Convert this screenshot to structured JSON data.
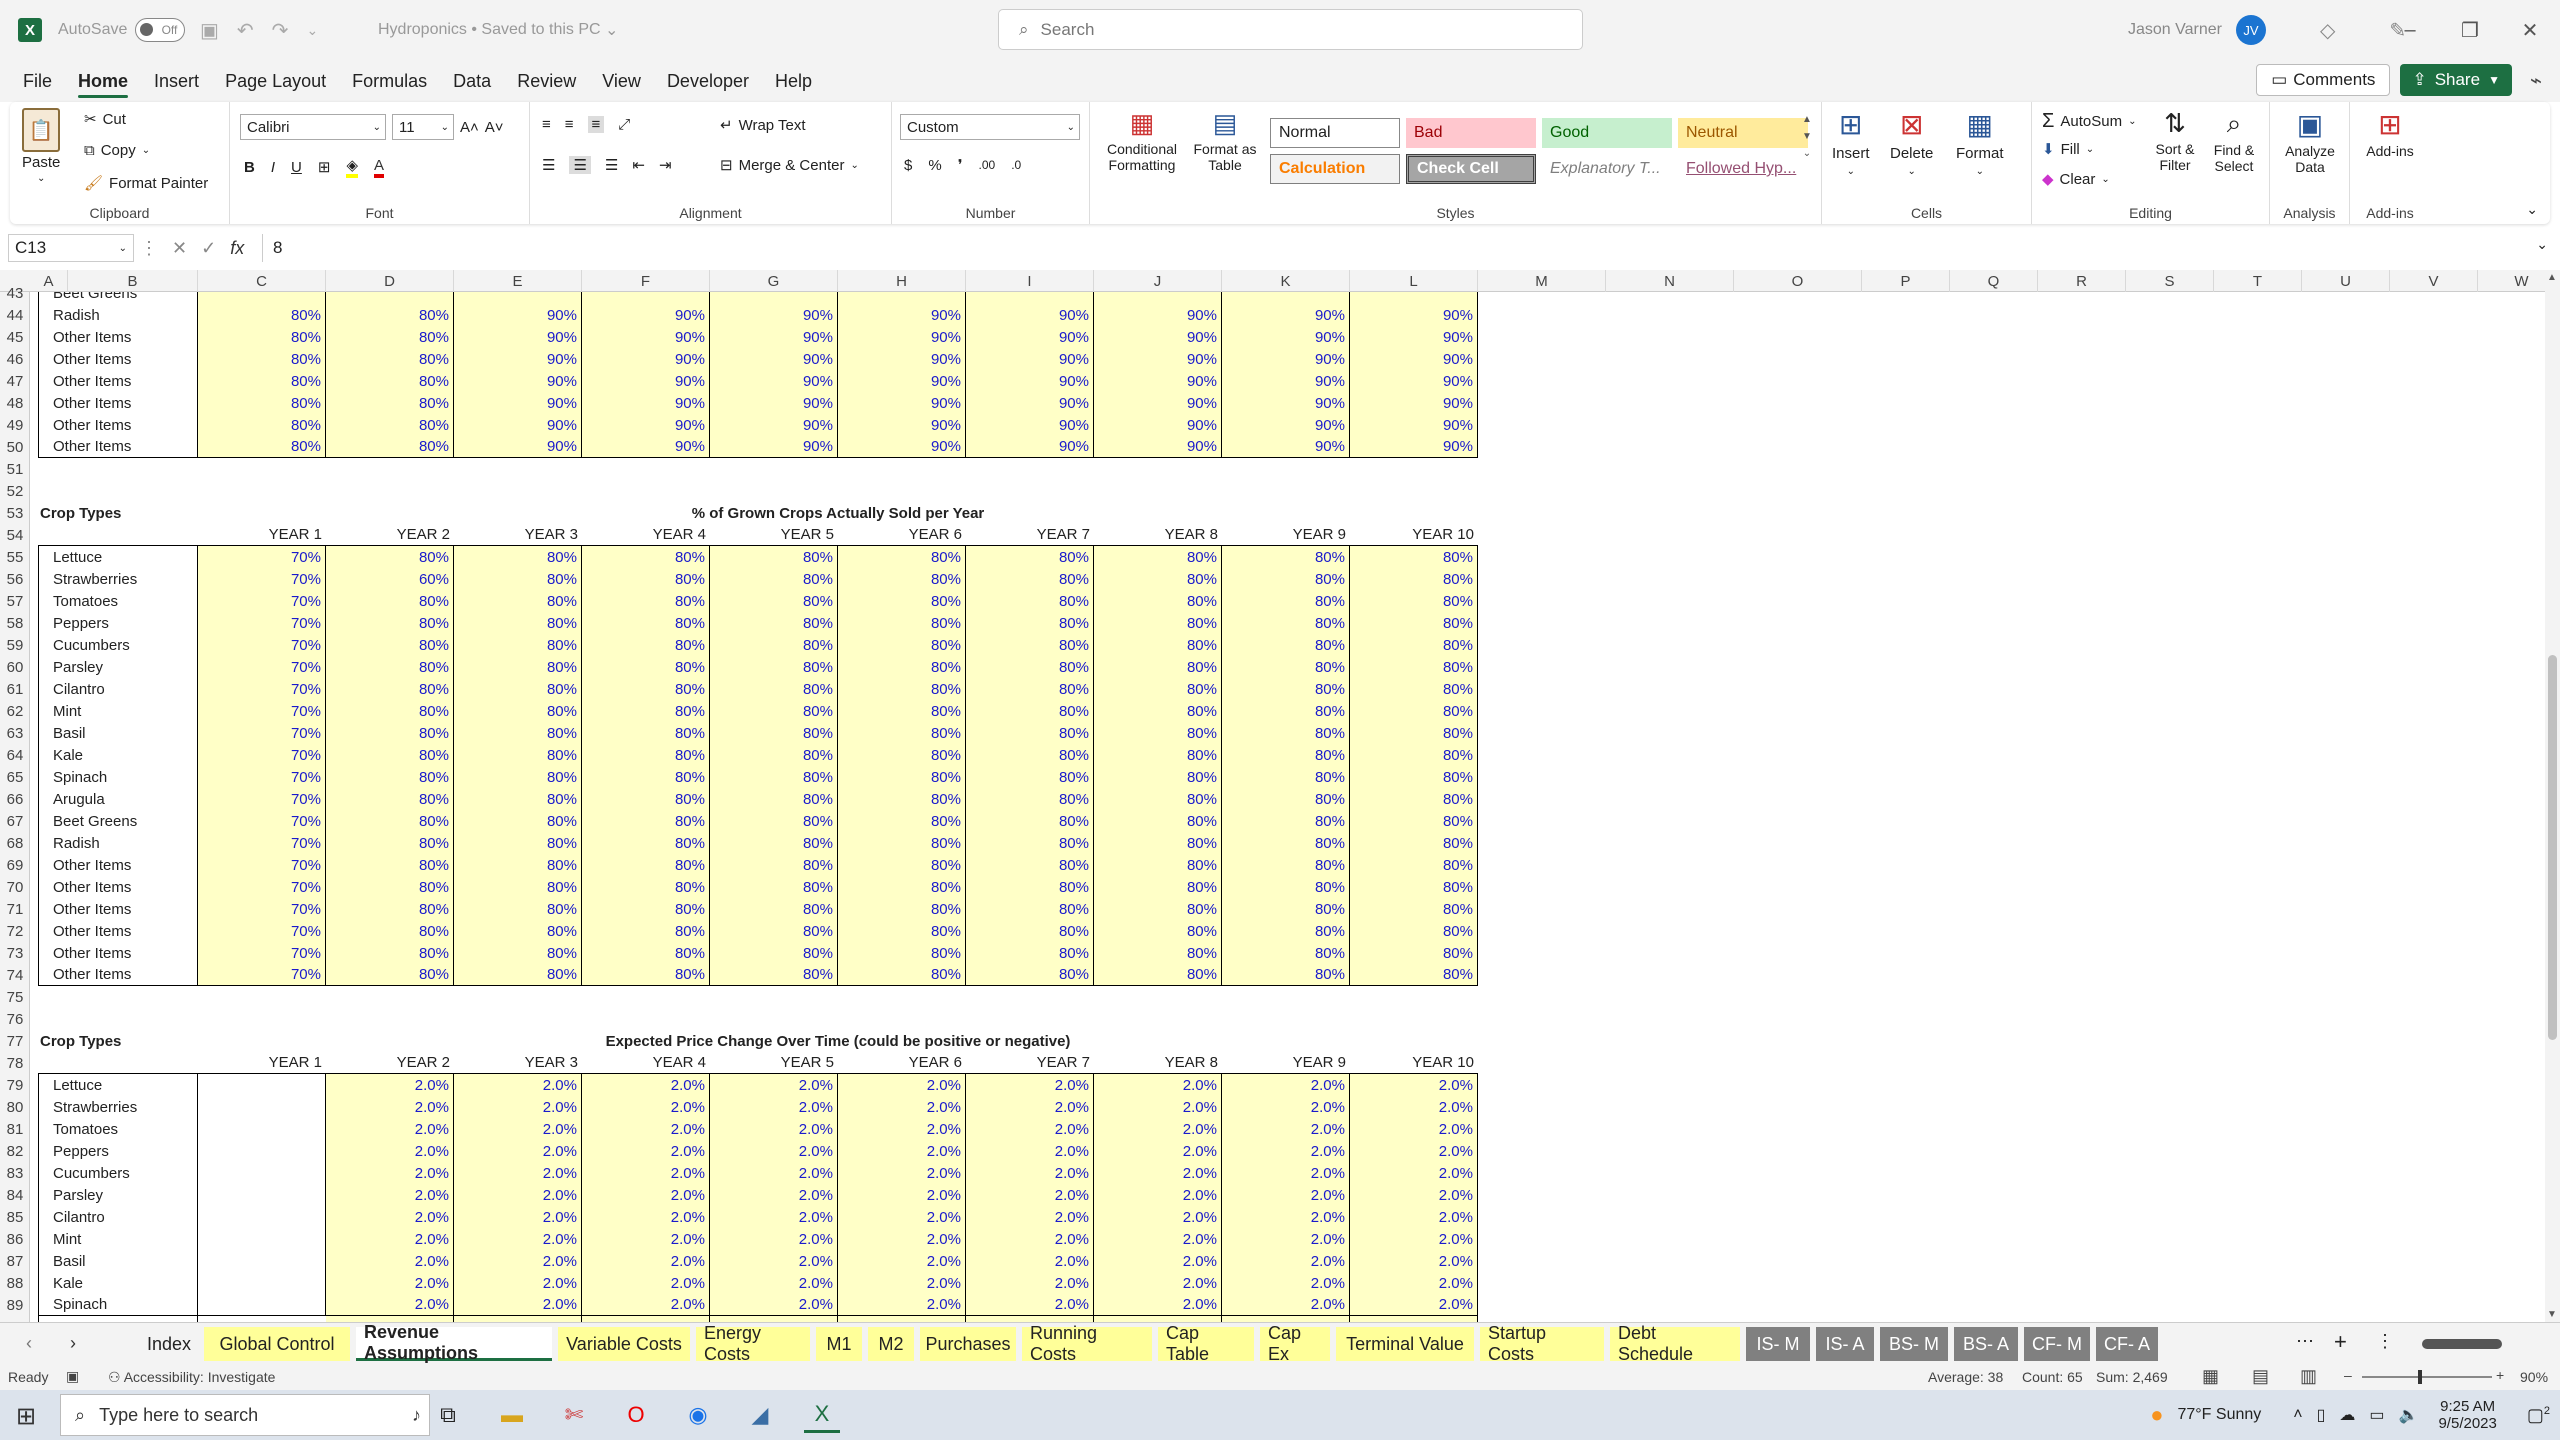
{
  "titlebar": {
    "autosave_label": "AutoSave",
    "autosave_state": "Off",
    "doc_title": "Hydroponics • Saved to this PC",
    "search_placeholder": "Search",
    "user_name": "Jason Varner",
    "user_initials": "JV"
  },
  "menu": {
    "tabs": [
      "File",
      "Home",
      "Insert",
      "Page Layout",
      "Formulas",
      "Data",
      "Review",
      "View",
      "Developer",
      "Help"
    ],
    "active": "Home",
    "comments": "Comments",
    "share": "Share"
  },
  "ribbon": {
    "clipboard": {
      "paste": "Paste",
      "cut": "Cut",
      "copy": "Copy",
      "format_painter": "Format Painter",
      "label": "Clipboard"
    },
    "font": {
      "name": "Calibri",
      "size": "11",
      "label": "Font"
    },
    "alignment": {
      "wrap": "Wrap Text",
      "merge": "Merge & Center",
      "label": "Alignment"
    },
    "number": {
      "format": "Custom",
      "label": "Number"
    },
    "styles": {
      "cond": "Conditional Formatting",
      "table": "Format as Table",
      "normal": "Normal",
      "bad": "Bad",
      "good": "Good",
      "neutral": "Neutral",
      "calculation": "Calculation",
      "check": "Check Cell",
      "explanatory": "Explanatory T...",
      "followed": "Followed Hyp...",
      "label": "Styles"
    },
    "cells": {
      "insert": "Insert",
      "delete": "Delete",
      "format": "Format",
      "label": "Cells"
    },
    "editing": {
      "autosum": "AutoSum",
      "fill": "Fill",
      "clear": "Clear",
      "sort": "Sort & Filter",
      "find": "Find & Select",
      "label": "Editing"
    },
    "analysis": {
      "analyze": "Analyze Data",
      "label": "Analysis"
    },
    "addins": {
      "addins": "Add-ins",
      "label": "Add-ins"
    }
  },
  "formula": {
    "name_box": "C13",
    "value": "8"
  },
  "columns": [
    "A",
    "B",
    "C",
    "D",
    "E",
    "F",
    "G",
    "H",
    "I",
    "J",
    "K",
    "L",
    "M",
    "N",
    "O",
    "P",
    "Q",
    "R",
    "S",
    "T",
    "U",
    "V",
    "W"
  ],
  "years": [
    "YEAR 1",
    "YEAR 2",
    "YEAR 3",
    "YEAR 4",
    "YEAR 5",
    "YEAR 6",
    "YEAR 7",
    "YEAR 8",
    "YEAR 9",
    "YEAR 10"
  ],
  "section1": {
    "partial_row_num": "43",
    "partial_label": "Beet Greens",
    "rows": [
      {
        "num": "44",
        "label": "Radish",
        "values": [
          "80%",
          "80%",
          "90%",
          "90%",
          "90%",
          "90%",
          "90%",
          "90%",
          "90%",
          "90%"
        ]
      },
      {
        "num": "45",
        "label": "Other Items",
        "values": [
          "80%",
          "80%",
          "90%",
          "90%",
          "90%",
          "90%",
          "90%",
          "90%",
          "90%",
          "90%"
        ]
      },
      {
        "num": "46",
        "label": "Other Items",
        "values": [
          "80%",
          "80%",
          "90%",
          "90%",
          "90%",
          "90%",
          "90%",
          "90%",
          "90%",
          "90%"
        ]
      },
      {
        "num": "47",
        "label": "Other Items",
        "values": [
          "80%",
          "80%",
          "90%",
          "90%",
          "90%",
          "90%",
          "90%",
          "90%",
          "90%",
          "90%"
        ]
      },
      {
        "num": "48",
        "label": "Other Items",
        "values": [
          "80%",
          "80%",
          "90%",
          "90%",
          "90%",
          "90%",
          "90%",
          "90%",
          "90%",
          "90%"
        ]
      },
      {
        "num": "49",
        "label": "Other Items",
        "values": [
          "80%",
          "80%",
          "90%",
          "90%",
          "90%",
          "90%",
          "90%",
          "90%",
          "90%",
          "90%"
        ]
      },
      {
        "num": "50",
        "label": "Other Items",
        "values": [
          "80%",
          "80%",
          "90%",
          "90%",
          "90%",
          "90%",
          "90%",
          "90%",
          "90%",
          "90%"
        ]
      }
    ],
    "blank_rows": [
      "51",
      "52"
    ]
  },
  "section2": {
    "title_row": "53",
    "header_row": "54",
    "crop_types": "Crop Types",
    "title": "% of Grown Crops Actually Sold per Year",
    "rows": [
      {
        "num": "55",
        "label": "Lettuce",
        "values": [
          "70%",
          "80%",
          "80%",
          "80%",
          "80%",
          "80%",
          "80%",
          "80%",
          "80%",
          "80%"
        ]
      },
      {
        "num": "56",
        "label": "Strawberries",
        "values": [
          "70%",
          "60%",
          "80%",
          "80%",
          "80%",
          "80%",
          "80%",
          "80%",
          "80%",
          "80%"
        ]
      },
      {
        "num": "57",
        "label": "Tomatoes",
        "values": [
          "70%",
          "80%",
          "80%",
          "80%",
          "80%",
          "80%",
          "80%",
          "80%",
          "80%",
          "80%"
        ]
      },
      {
        "num": "58",
        "label": "Peppers",
        "values": [
          "70%",
          "80%",
          "80%",
          "80%",
          "80%",
          "80%",
          "80%",
          "80%",
          "80%",
          "80%"
        ]
      },
      {
        "num": "59",
        "label": "Cucumbers",
        "values": [
          "70%",
          "80%",
          "80%",
          "80%",
          "80%",
          "80%",
          "80%",
          "80%",
          "80%",
          "80%"
        ]
      },
      {
        "num": "60",
        "label": "Parsley",
        "values": [
          "70%",
          "80%",
          "80%",
          "80%",
          "80%",
          "80%",
          "80%",
          "80%",
          "80%",
          "80%"
        ]
      },
      {
        "num": "61",
        "label": "Cilantro",
        "values": [
          "70%",
          "80%",
          "80%",
          "80%",
          "80%",
          "80%",
          "80%",
          "80%",
          "80%",
          "80%"
        ]
      },
      {
        "num": "62",
        "label": "Mint",
        "values": [
          "70%",
          "80%",
          "80%",
          "80%",
          "80%",
          "80%",
          "80%",
          "80%",
          "80%",
          "80%"
        ]
      },
      {
        "num": "63",
        "label": "Basil",
        "values": [
          "70%",
          "80%",
          "80%",
          "80%",
          "80%",
          "80%",
          "80%",
          "80%",
          "80%",
          "80%"
        ]
      },
      {
        "num": "64",
        "label": "Kale",
        "values": [
          "70%",
          "80%",
          "80%",
          "80%",
          "80%",
          "80%",
          "80%",
          "80%",
          "80%",
          "80%"
        ]
      },
      {
        "num": "65",
        "label": "Spinach",
        "values": [
          "70%",
          "80%",
          "80%",
          "80%",
          "80%",
          "80%",
          "80%",
          "80%",
          "80%",
          "80%"
        ]
      },
      {
        "num": "66",
        "label": "Arugula",
        "values": [
          "70%",
          "80%",
          "80%",
          "80%",
          "80%",
          "80%",
          "80%",
          "80%",
          "80%",
          "80%"
        ]
      },
      {
        "num": "67",
        "label": "Beet Greens",
        "values": [
          "70%",
          "80%",
          "80%",
          "80%",
          "80%",
          "80%",
          "80%",
          "80%",
          "80%",
          "80%"
        ]
      },
      {
        "num": "68",
        "label": "Radish",
        "values": [
          "70%",
          "80%",
          "80%",
          "80%",
          "80%",
          "80%",
          "80%",
          "80%",
          "80%",
          "80%"
        ]
      },
      {
        "num": "69",
        "label": "Other Items",
        "values": [
          "70%",
          "80%",
          "80%",
          "80%",
          "80%",
          "80%",
          "80%",
          "80%",
          "80%",
          "80%"
        ]
      },
      {
        "num": "70",
        "label": "Other Items",
        "values": [
          "70%",
          "80%",
          "80%",
          "80%",
          "80%",
          "80%",
          "80%",
          "80%",
          "80%",
          "80%"
        ]
      },
      {
        "num": "71",
        "label": "Other Items",
        "values": [
          "70%",
          "80%",
          "80%",
          "80%",
          "80%",
          "80%",
          "80%",
          "80%",
          "80%",
          "80%"
        ]
      },
      {
        "num": "72",
        "label": "Other Items",
        "values": [
          "70%",
          "80%",
          "80%",
          "80%",
          "80%",
          "80%",
          "80%",
          "80%",
          "80%",
          "80%"
        ]
      },
      {
        "num": "73",
        "label": "Other Items",
        "values": [
          "70%",
          "80%",
          "80%",
          "80%",
          "80%",
          "80%",
          "80%",
          "80%",
          "80%",
          "80%"
        ]
      },
      {
        "num": "74",
        "label": "Other Items",
        "values": [
          "70%",
          "80%",
          "80%",
          "80%",
          "80%",
          "80%",
          "80%",
          "80%",
          "80%",
          "80%"
        ]
      }
    ],
    "blank_rows": [
      "75",
      "76"
    ]
  },
  "section3": {
    "title_row": "77",
    "header_row": "78",
    "crop_types": "Crop Types",
    "title": "Expected Price Change Over Time (could be positive or negative)",
    "rows": [
      {
        "num": "79",
        "label": "Lettuce",
        "values": [
          "",
          "2.0%",
          "2.0%",
          "2.0%",
          "2.0%",
          "2.0%",
          "2.0%",
          "2.0%",
          "2.0%",
          "2.0%"
        ]
      },
      {
        "num": "80",
        "label": "Strawberries",
        "values": [
          "",
          "2.0%",
          "2.0%",
          "2.0%",
          "2.0%",
          "2.0%",
          "2.0%",
          "2.0%",
          "2.0%",
          "2.0%"
        ]
      },
      {
        "num": "81",
        "label": "Tomatoes",
        "values": [
          "",
          "2.0%",
          "2.0%",
          "2.0%",
          "2.0%",
          "2.0%",
          "2.0%",
          "2.0%",
          "2.0%",
          "2.0%"
        ]
      },
      {
        "num": "82",
        "label": "Peppers",
        "values": [
          "",
          "2.0%",
          "2.0%",
          "2.0%",
          "2.0%",
          "2.0%",
          "2.0%",
          "2.0%",
          "2.0%",
          "2.0%"
        ]
      },
      {
        "num": "83",
        "label": "Cucumbers",
        "values": [
          "",
          "2.0%",
          "2.0%",
          "2.0%",
          "2.0%",
          "2.0%",
          "2.0%",
          "2.0%",
          "2.0%",
          "2.0%"
        ]
      },
      {
        "num": "84",
        "label": "Parsley",
        "values": [
          "",
          "2.0%",
          "2.0%",
          "2.0%",
          "2.0%",
          "2.0%",
          "2.0%",
          "2.0%",
          "2.0%",
          "2.0%"
        ]
      },
      {
        "num": "85",
        "label": "Cilantro",
        "values": [
          "",
          "2.0%",
          "2.0%",
          "2.0%",
          "2.0%",
          "2.0%",
          "2.0%",
          "2.0%",
          "2.0%",
          "2.0%"
        ]
      },
      {
        "num": "86",
        "label": "Mint",
        "values": [
          "",
          "2.0%",
          "2.0%",
          "2.0%",
          "2.0%",
          "2.0%",
          "2.0%",
          "2.0%",
          "2.0%",
          "2.0%"
        ]
      },
      {
        "num": "87",
        "label": "Basil",
        "values": [
          "",
          "2.0%",
          "2.0%",
          "2.0%",
          "2.0%",
          "2.0%",
          "2.0%",
          "2.0%",
          "2.0%",
          "2.0%"
        ]
      },
      {
        "num": "88",
        "label": "Kale",
        "values": [
          "",
          "2.0%",
          "2.0%",
          "2.0%",
          "2.0%",
          "2.0%",
          "2.0%",
          "2.0%",
          "2.0%",
          "2.0%"
        ]
      },
      {
        "num": "89",
        "label": "Spinach",
        "values": [
          "",
          "2.0%",
          "2.0%",
          "2.0%",
          "2.0%",
          "2.0%",
          "2.0%",
          "2.0%",
          "2.0%",
          "2.0%"
        ]
      }
    ]
  },
  "sheets": [
    {
      "name": "Index",
      "style": "plain"
    },
    {
      "name": "Global Control",
      "style": "yellow"
    },
    {
      "name": "Revenue Assumptions",
      "style": "active"
    },
    {
      "name": "Variable Costs",
      "style": "yellow"
    },
    {
      "name": "Energy Costs",
      "style": "yellow"
    },
    {
      "name": "M1",
      "style": "yellow"
    },
    {
      "name": "M2",
      "style": "yellow"
    },
    {
      "name": "Purchases",
      "style": "yellow"
    },
    {
      "name": "Running Costs",
      "style": "yellow"
    },
    {
      "name": "Cap Table",
      "style": "yellow"
    },
    {
      "name": "Cap Ex",
      "style": "yellow"
    },
    {
      "name": "Terminal Value",
      "style": "yellow"
    },
    {
      "name": "Startup Costs",
      "style": "yellow"
    },
    {
      "name": "Debt Schedule",
      "style": "yellow"
    },
    {
      "name": "IS- M",
      "style": "gray"
    },
    {
      "name": "IS- A",
      "style": "gray"
    },
    {
      "name": "BS- M",
      "style": "gray"
    },
    {
      "name": "BS- A",
      "style": "gray"
    },
    {
      "name": "CF- M",
      "style": "gray"
    },
    {
      "name": "CF- A",
      "style": "gray"
    }
  ],
  "status": {
    "ready": "Ready",
    "accessibility": "Accessibility: Investigate",
    "average": "Average: 38",
    "count": "Count: 65",
    "sum": "Sum: 2,469",
    "zoom": "90%"
  },
  "taskbar": {
    "search_placeholder": "Type here to search",
    "weather": "77°F  Sunny",
    "time": "9:25 AM",
    "date": "9/5/2023",
    "notifications": "2"
  },
  "colors": {
    "accent": "#1d6f42",
    "input_fill": "#ffffc7",
    "input_text": "#1a1acc",
    "sheet_yellow": "#ffff99",
    "sheet_gray": "#808080"
  }
}
